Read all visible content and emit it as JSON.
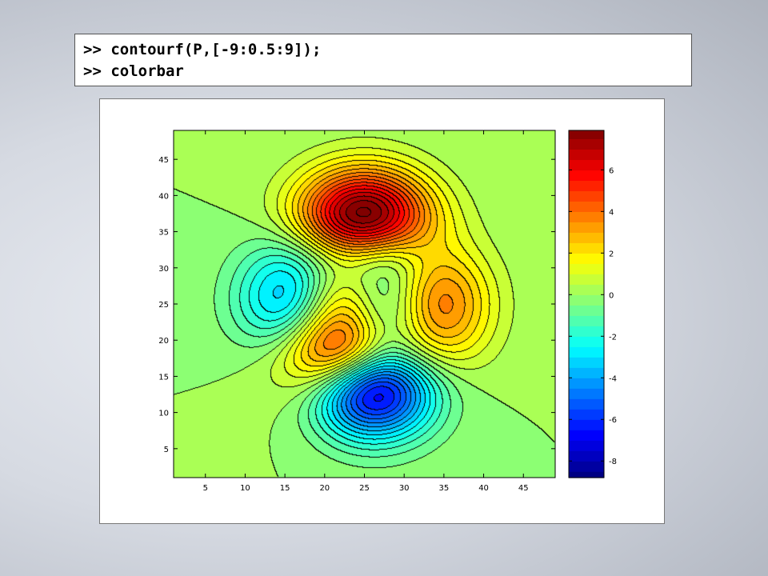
{
  "command_window": {
    "lines": [
      ">> contourf(P,[-9:0.5:9]);",
      ">> colorbar"
    ]
  },
  "chart_data": {
    "type": "heatmap",
    "subtype": "filled-contour",
    "function": "peaks",
    "grid_size": 49,
    "contour_levels": {
      "start": -9,
      "step": 0.5,
      "stop": 9
    },
    "colormap": "jet",
    "title": "",
    "xlabel": "",
    "ylabel": "",
    "xlim": [
      1,
      49
    ],
    "ylim": [
      1,
      49
    ],
    "x_ticks": [
      5,
      10,
      15,
      20,
      25,
      30,
      35,
      40,
      45
    ],
    "y_ticks": [
      5,
      10,
      15,
      20,
      25,
      30,
      35,
      40,
      45
    ],
    "colorbar": {
      "range": [
        -8.8,
        7.9
      ],
      "ticks": [
        -8,
        -6,
        -4,
        -2,
        0,
        2,
        4,
        6
      ]
    },
    "extrema": {
      "max": {
        "x": 25,
        "y": 38,
        "value": 8.1
      },
      "min": {
        "x": 27,
        "y": 12,
        "value": -6.5
      }
    }
  }
}
